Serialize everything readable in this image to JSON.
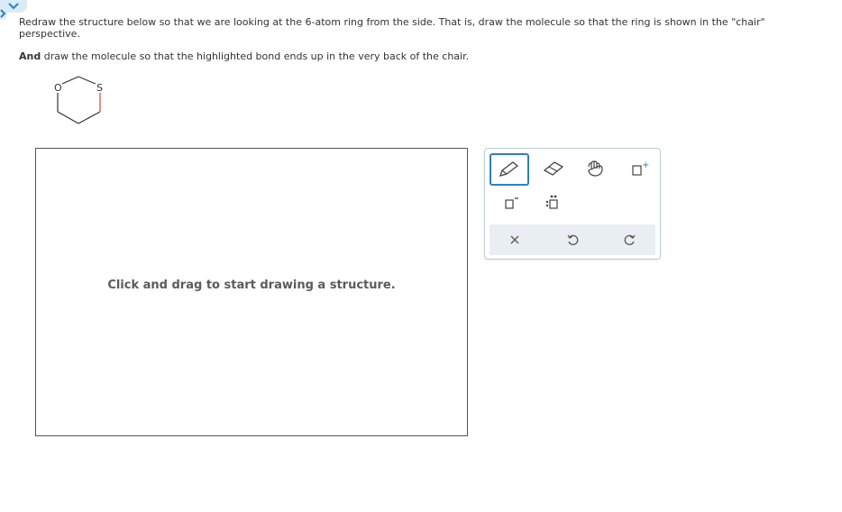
{
  "question": {
    "line1": "Redraw the structure below so that we are looking at the 6-atom ring from the side. That is, draw the molecule so that the ring is shown in the \"chair\" perspective.",
    "line2_bold": "And",
    "line2_rest": " draw the molecule so that the highlighted bond ends up in the very back of the chair."
  },
  "molecule": {
    "atom_o": "O",
    "atom_s": "S",
    "highlight_color": "#e05a5a",
    "bond_color": "#333333"
  },
  "canvas": {
    "hint": "Click and drag to start drawing a structure."
  },
  "toolbar": {
    "tools": [
      "pencil-icon",
      "eraser-icon",
      "grab-hand-icon",
      "charge-icon",
      "single-bond-icon",
      "lone-pair-icon",
      "clear-icon",
      "undo-icon",
      "redo-icon"
    ],
    "charge_label": "+",
    "accent": "#2f7fbf"
  }
}
